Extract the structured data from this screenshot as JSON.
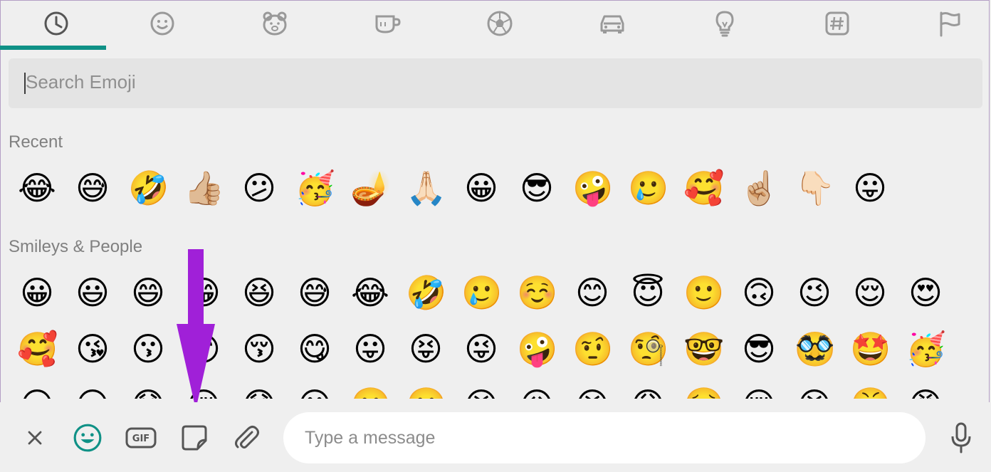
{
  "tabs": [
    {
      "name": "recent",
      "icon": "clock-icon",
      "active": true
    },
    {
      "name": "smileys",
      "icon": "smiley-icon"
    },
    {
      "name": "animals",
      "icon": "bear-icon"
    },
    {
      "name": "food",
      "icon": "cup-icon"
    },
    {
      "name": "activity",
      "icon": "soccer-ball-icon"
    },
    {
      "name": "travel",
      "icon": "car-icon"
    },
    {
      "name": "objects",
      "icon": "lightbulb-icon"
    },
    {
      "name": "symbols",
      "icon": "hashtag-icon"
    },
    {
      "name": "flags",
      "icon": "flag-icon"
    }
  ],
  "colors": {
    "accent": "#0f9186",
    "arrow": "#a020d8",
    "background": "#efefef"
  },
  "search": {
    "placeholder": "Search Emoji"
  },
  "sections": {
    "recent": {
      "title": "Recent",
      "emojis": [
        "😂",
        "😅",
        "🤣",
        "👍🏼",
        "😕",
        "🥳",
        "🪔",
        "🙏🏻",
        "😀",
        "😎",
        "🤪",
        "🥲",
        "🥰",
        "☝🏼",
        "👇🏻",
        "😛"
      ]
    },
    "smileys": {
      "title": "Smileys & People",
      "row1": [
        "😀",
        "😃",
        "😄",
        "😁",
        "😆",
        "😅",
        "😂",
        "🤣",
        "🥲",
        "☺️",
        "😊",
        "😇",
        "🙂",
        "🙃",
        "😉",
        "😌",
        "😍"
      ],
      "row2": [
        "🥰",
        "😘",
        "😗",
        "😙",
        "😚",
        "😋",
        "😛",
        "😝",
        "😜",
        "🤪",
        "🤨",
        "🧐",
        "🤓",
        "😎",
        "🥸",
        "🤩",
        "🥳"
      ],
      "row3": [
        "😏",
        "😒",
        "😞",
        "😔",
        "😟",
        "😕",
        "🙁",
        "☹️",
        "😣",
        "😖",
        "😫",
        "😩",
        "🥺",
        "😢",
        "😭",
        "😤",
        "😠"
      ]
    }
  },
  "bottom_bar": {
    "close_icon": "close-icon",
    "emoji_icon": "emoji-icon",
    "gif_label": "GIF",
    "sticker_icon": "sticker-icon",
    "attach_icon": "paperclip-icon",
    "message_placeholder": "Type a message",
    "mic_icon": "microphone-icon"
  }
}
